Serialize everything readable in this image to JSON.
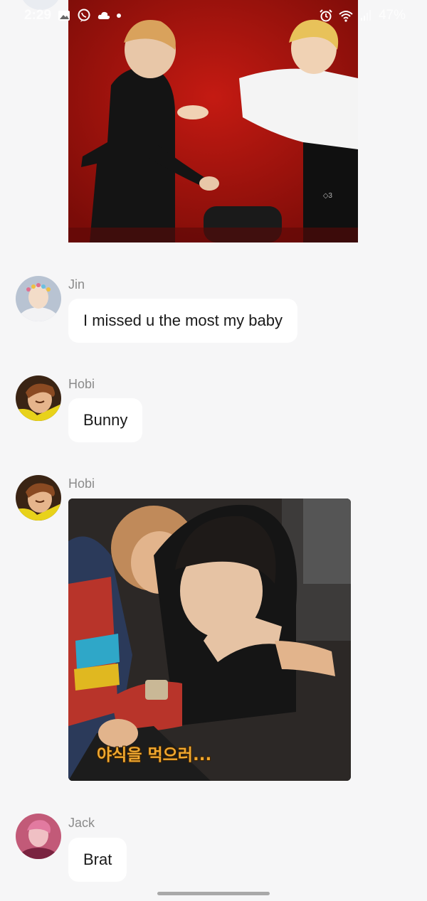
{
  "status_bar": {
    "time": "2:29",
    "battery": "47%",
    "icons": [
      "gallery-icon",
      "viber-icon",
      "cloud-icon",
      "notification-dot",
      "alarm-icon",
      "wifi-icon",
      "signal-icon"
    ]
  },
  "messages": [
    {
      "type": "image",
      "sender": "",
      "image": "red-studio-photo"
    },
    {
      "type": "text",
      "sender": "Jin",
      "text": "I missed u the most my baby",
      "avatar": "jin-avatar"
    },
    {
      "type": "text",
      "sender": "Hobi",
      "text": "Bunny",
      "avatar": "hobi-avatar"
    },
    {
      "type": "image",
      "sender": "Hobi",
      "image": "hug-photo",
      "caption": "야식을 먹으러...",
      "avatar": "hobi-avatar"
    },
    {
      "type": "text",
      "sender": "Jack",
      "text": "Brat",
      "avatar": "jack-avatar"
    }
  ],
  "colors": {
    "background": "#f6f6f7",
    "bubble": "#ffffff",
    "sender_name": "#8b8b8b",
    "message_text": "#1a1a1a"
  }
}
